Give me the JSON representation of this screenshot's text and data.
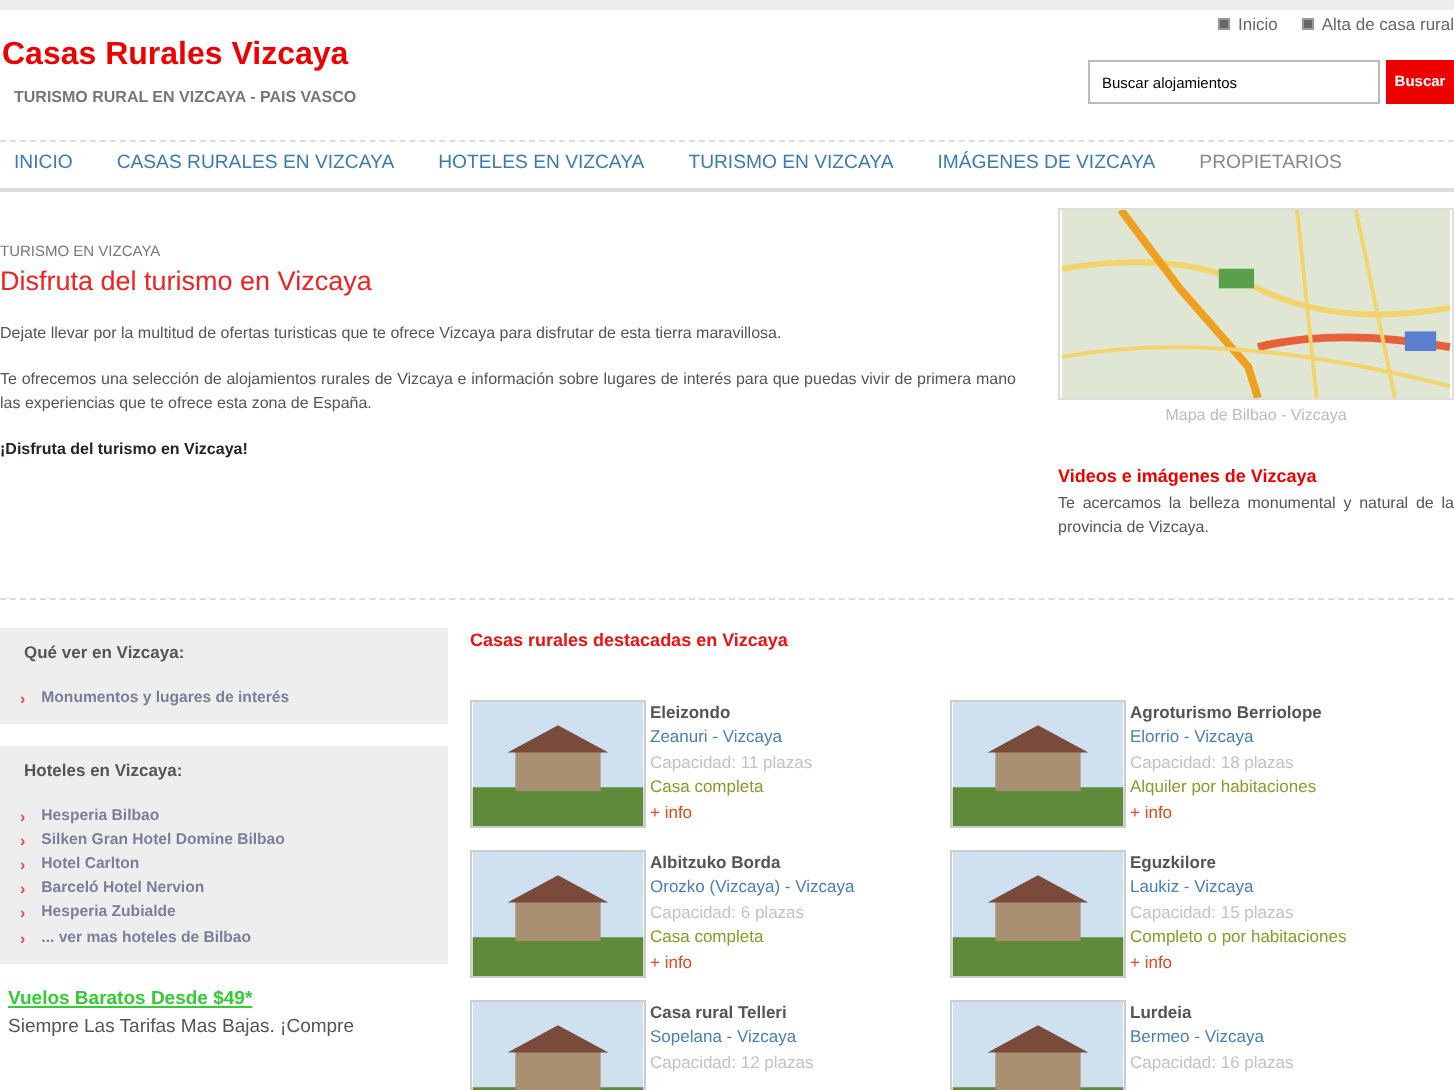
{
  "top_links": [
    {
      "label": "Inicio"
    },
    {
      "label": "Alta de casa rural"
    }
  ],
  "site": {
    "title": "Casas Rurales Vizcaya",
    "tagline": "TURISMO RURAL EN VIZCAYA - PAIS VASCO"
  },
  "search": {
    "value": "Buscar alojamientos",
    "button": "Buscar"
  },
  "nav": [
    {
      "label": "INICIO",
      "selected": false
    },
    {
      "label": "CASAS RURALES EN VIZCAYA",
      "selected": false
    },
    {
      "label": "HOTELES EN VIZCAYA",
      "selected": false
    },
    {
      "label": "TURISMO EN VIZCAYA",
      "selected": false
    },
    {
      "label": "IMÁGENES DE VIZCAYA",
      "selected": false
    },
    {
      "label": "PROPIETARIOS",
      "selected": true
    }
  ],
  "intro": {
    "breadcrumb": "TURISMO EN VIZCAYA",
    "heading": "Disfruta del turismo en Vizcaya",
    "paragraphs": [
      "Dejate llevar por la multitud de ofertas turisticas que te ofrece Vizcaya para disfrutar de esta tierra maravillosa.",
      "Te ofrecemos una selección de alojamientos rurales de Vizcaya e información sobre lugares de interés para que puedas vivir de primera mano las experiencias que te ofrece esta zona de España."
    ],
    "closing": "¡Disfruta del turismo en Vizcaya!"
  },
  "map": {
    "caption": "Mapa de Bilbao - Vizcaya"
  },
  "media": {
    "title": "Videos e imágenes de Vizcaya",
    "text": "Te acercamos la belleza monumental y natural de la provincia de Vizcaya."
  },
  "sidebar": [
    {
      "title": "Qué ver en Vizcaya:",
      "items": [
        {
          "bullet": "›",
          "label": "Monumentos y lugares de interés"
        }
      ]
    },
    {
      "title": "Hoteles en Vizcaya:",
      "items": [
        {
          "bullet": "›",
          "label": "Hesperia Bilbao"
        },
        {
          "bullet": "›",
          "label": "Silken Gran Hotel Domine Bilbao"
        },
        {
          "bullet": "›",
          "label": "Hotel Carlton"
        },
        {
          "bullet": "›",
          "label": "Barceló Hotel Nervion"
        },
        {
          "bullet": "›",
          "label": "Hesperia Zubialde"
        },
        {
          "bullet": "›",
          "label": "... ver mas hoteles de Bilbao"
        }
      ]
    }
  ],
  "ad": {
    "title": "Vuelos Baratos Desde $49*",
    "text": "Siempre Las Tarifas Mas Bajas. ¡Compre"
  },
  "featured": {
    "title": "Casas rurales destacadas en Vizcaya",
    "houses": [
      {
        "name": "Eleizondo",
        "location": "Zeanuri - Vizcaya",
        "capacity": "Capacidad: 11 plazas",
        "rental": "Casa completa",
        "more": "+ info"
      },
      {
        "name": "Agroturismo Berriolope",
        "location": "Elorrio - Vizcaya",
        "capacity": "Capacidad: 18 plazas",
        "rental": "Alquiler por habitaciones",
        "more": "+ info"
      },
      {
        "name": "Albitzuko Borda",
        "location": "Orozko (Vizcaya) - Vizcaya",
        "capacity": "Capacidad: 6 plazas",
        "rental": "Casa completa",
        "more": "+ info"
      },
      {
        "name": "Eguzkilore",
        "location": "Laukiz - Vizcaya",
        "capacity": "Capacidad: 15 plazas",
        "rental": "Completo o por habitaciones",
        "more": "+ info"
      },
      {
        "name": "Casa rural Telleri",
        "location": "Sopelana - Vizcaya",
        "capacity": "Capacidad: 12 plazas"
      },
      {
        "name": "Lurdeia",
        "location": "Bermeo - Vizcaya",
        "capacity": "Capacidad: 16 plazas"
      }
    ]
  }
}
